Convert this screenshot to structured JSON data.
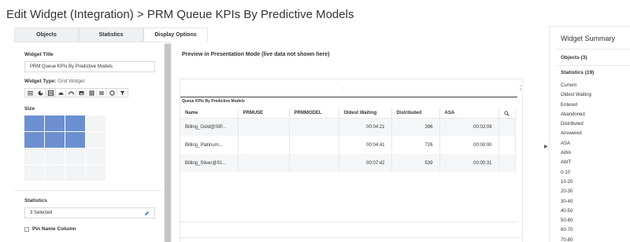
{
  "page": {
    "title": "Edit Widget (Integration) > PRM Queue KPIs By Predictive Models"
  },
  "tabs": [
    {
      "label": "Objects"
    },
    {
      "label": "Statistics"
    },
    {
      "label": "Display Options"
    }
  ],
  "left_panel": {
    "widget_title_label": "Widget Title",
    "widget_title_value": "PRM Queue KPIs By Predictive Models",
    "widget_type_label": "Widget Type:",
    "widget_type_value": "Grid Widget",
    "widget_types": [
      "list-icon",
      "pie-icon",
      "grid-icon",
      "gauge-icon",
      "gauge-alt-icon",
      "image-icon",
      "tiles-icon",
      "bars-icon",
      "donut-icon",
      "filter-icon"
    ],
    "size_label": "Size",
    "statistics_label": "Statistics",
    "statistics_value": "3 Selected",
    "pin_name_label": "Pin Name Column"
  },
  "preview": {
    "title": "Preview in Presentation Mode (live data not shown here)",
    "drag_handle": "∷",
    "widget_caption": "Queue KPIs By Predictive Models",
    "columns": [
      "Name",
      "PRMUSE",
      "PRMMODEL",
      "Oldest Waiting",
      "Distributed",
      "ASA"
    ],
    "rows": [
      {
        "name": "Billing_Gold@SIP...",
        "prmuse": "",
        "prmmodel": "",
        "oldest_waiting": "00:04:21",
        "distributed": "396",
        "asa": "00:02:09"
      },
      {
        "name": "Billing_Platinum...",
        "prmuse": "",
        "prmmodel": "",
        "oldest_waiting": "00:04:41",
        "distributed": "726",
        "asa": "00:00:00"
      },
      {
        "name": "Billing_Silver@SI...",
        "prmuse": "",
        "prmmodel": "",
        "oldest_waiting": "00:07:42",
        "distributed": "539",
        "asa": "00:00:31"
      }
    ]
  },
  "summary": {
    "title": "Widget Summary",
    "objects_label": "Objects (3)",
    "statistics_label": "Statistics (19)",
    "statistics_items": [
      "Current",
      "Oldest Waiting",
      "Entered",
      "Abandoned",
      "Distributed",
      "Answered",
      "ASA",
      "AWA",
      "AWT",
      "0-10",
      "10-20",
      "20-30",
      "30-40",
      "40-50",
      "50-60",
      "60-70",
      "70-80"
    ]
  },
  "colors": {
    "size_selected": "#6b8fd1",
    "tab_inactive": "#eef0f2"
  }
}
